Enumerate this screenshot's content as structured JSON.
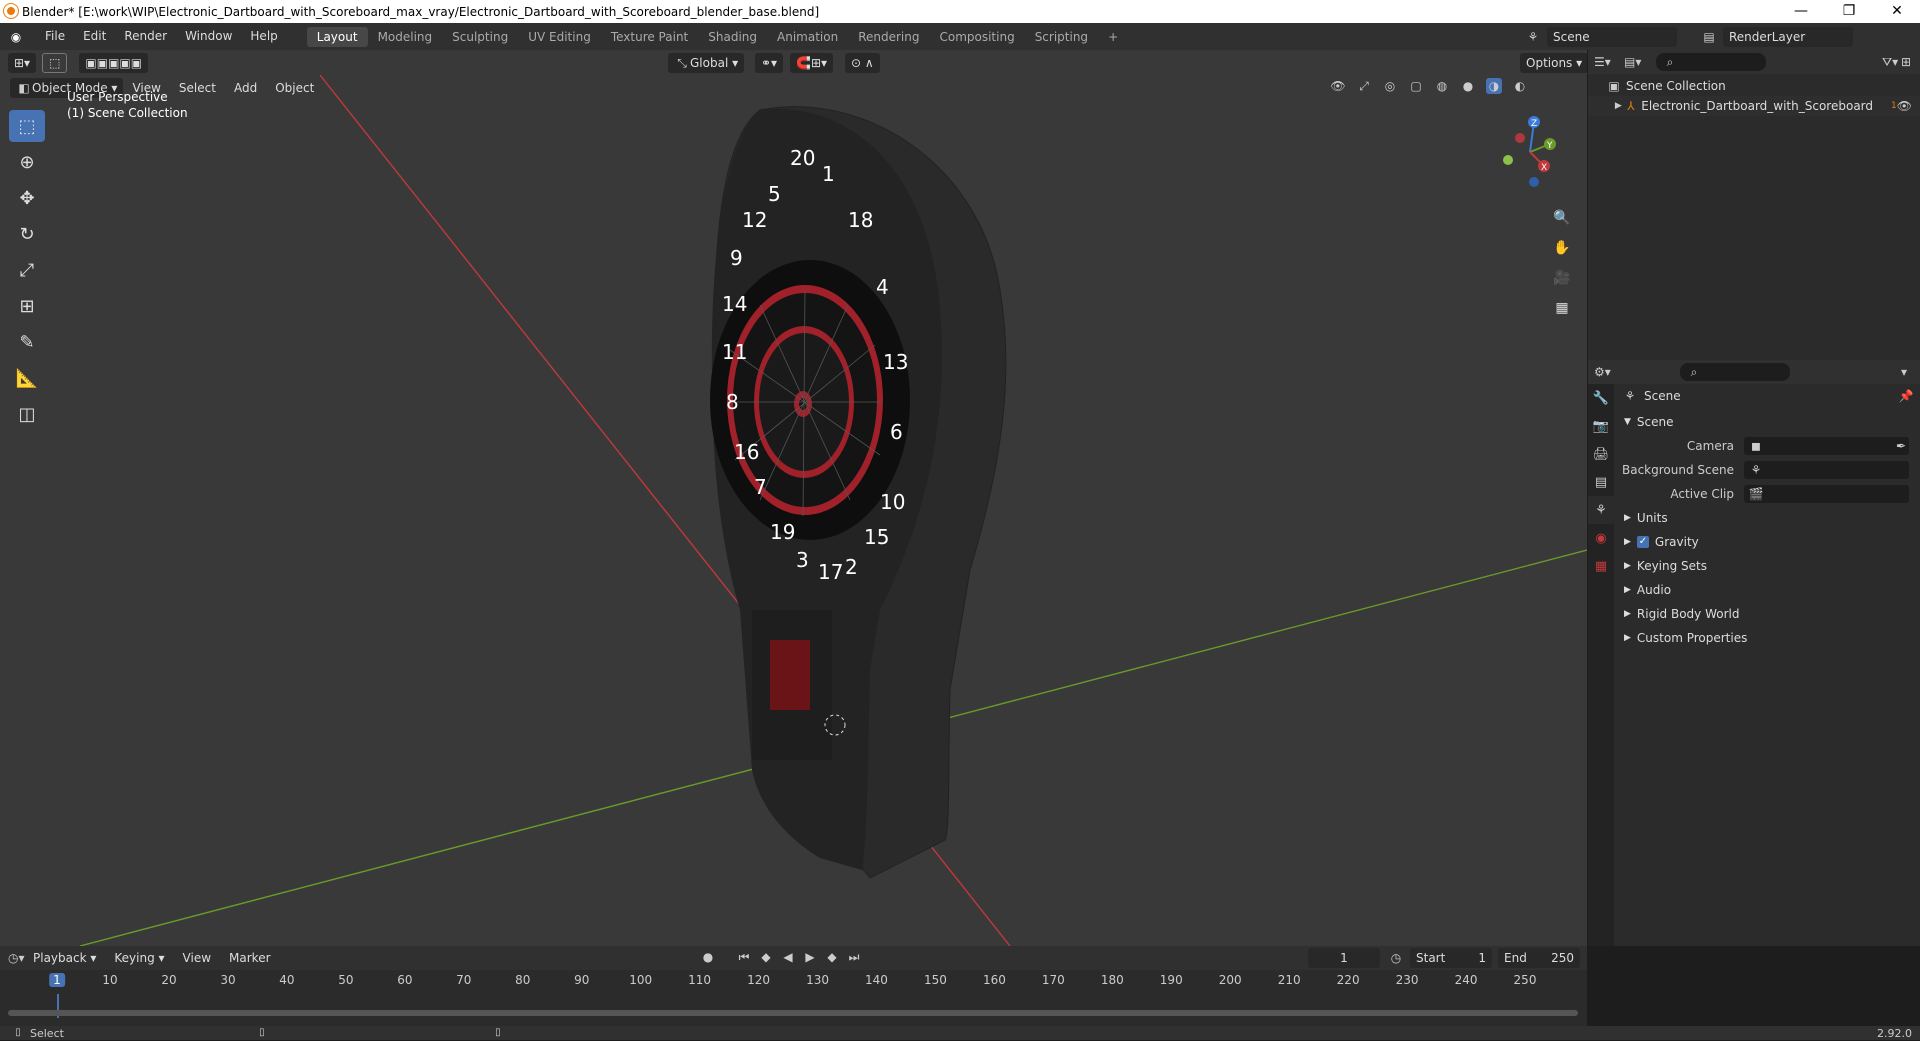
{
  "window": {
    "title": "Blender* [E:\\work\\WIP\\Electronic_Dartboard_with_Scoreboard_max_vray/Electronic_Dartboard_with_Scoreboard_blender_base.blend]",
    "minimize": "—",
    "restore": "❐",
    "close": "✕"
  },
  "menubar": {
    "items": [
      "File",
      "Edit",
      "Render",
      "Window",
      "Help"
    ],
    "workspaces": [
      "Layout",
      "Modeling",
      "Sculpting",
      "UV Editing",
      "Texture Paint",
      "Shading",
      "Animation",
      "Rendering",
      "Compositing",
      "Scripting"
    ],
    "active_workspace": "Layout",
    "add_tab": "+",
    "scene_name": "Scene",
    "view_layer": "RenderLayer"
  },
  "viewport": {
    "mode": "Object Mode",
    "menus": [
      "View",
      "Select",
      "Add",
      "Object"
    ],
    "transform_orientation": "Global",
    "options": "Options",
    "overlay_line1": "User Perspective",
    "overlay_line2": "(1) Scene Collection",
    "gizmo_axes": {
      "z": "Z",
      "y": "Y",
      "x": "X"
    }
  },
  "dartboard": {
    "numbers": [
      "20",
      "1",
      "18",
      "4",
      "13",
      "6",
      "10",
      "15",
      "2",
      "17",
      "3",
      "19",
      "7",
      "16",
      "8",
      "11",
      "14",
      "9",
      "12",
      "5"
    ]
  },
  "outliner": {
    "root": "Scene Collection",
    "item": "Electronic_Dartboard_with_Scoreboard",
    "item_badge": "1"
  },
  "properties": {
    "header": "Scene",
    "section": "Scene",
    "fields": [
      {
        "label": "Camera",
        "value": ""
      },
      {
        "label": "Background Scene",
        "value": ""
      },
      {
        "label": "Active Clip",
        "value": ""
      }
    ],
    "subsections": [
      "Units",
      "Gravity",
      "Keying Sets",
      "Audio",
      "Rigid Body World",
      "Custom Properties"
    ],
    "gravity_checked": true
  },
  "timeline": {
    "menus": [
      "Playback",
      "Keying",
      "View",
      "Marker"
    ],
    "current_frame": "1",
    "start_label": "Start",
    "start_value": "1",
    "end_label": "End",
    "end_value": "250",
    "ticks": [
      "1",
      "10",
      "20",
      "30",
      "40",
      "50",
      "60",
      "70",
      "80",
      "90",
      "100",
      "110",
      "120",
      "130",
      "140",
      "150",
      "160",
      "170",
      "180",
      "190",
      "200",
      "210",
      "220",
      "230",
      "240",
      "250"
    ]
  },
  "statusbar": {
    "left": "Select",
    "version": "2.92.0"
  },
  "colors": {
    "accent": "#4772b3",
    "x_axis": "#c0393b",
    "y_axis": "#6a9a2a",
    "board_red": "#a0212a",
    "board_black": "#141414"
  }
}
